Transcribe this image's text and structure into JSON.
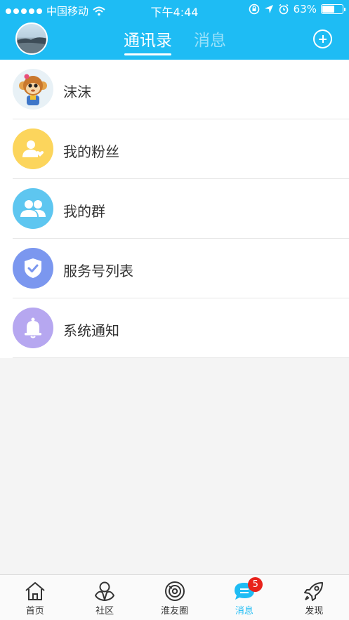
{
  "status_bar": {
    "carrier": "中国移动",
    "time": "下午4:44",
    "battery_percent": "63%",
    "battery_level": 0.63
  },
  "header": {
    "tabs": [
      {
        "label": "通讯录",
        "active": true
      },
      {
        "label": "消息",
        "active": false
      }
    ],
    "add_icon": "plus-circle-icon"
  },
  "contacts": [
    {
      "label": "沫沫",
      "icon": "monkey-avatar"
    },
    {
      "label": "我的粉丝",
      "icon": "fans-icon",
      "color": "#fcd55c"
    },
    {
      "label": "我的群",
      "icon": "group-icon",
      "color": "#5ec6f0"
    },
    {
      "label": "服务号列表",
      "icon": "shield-check-icon",
      "color": "#7b97ef"
    },
    {
      "label": "系统通知",
      "icon": "bell-icon",
      "color": "#b6a7f0"
    }
  ],
  "tab_bar": {
    "items": [
      {
        "label": "首页",
        "icon": "home-icon"
      },
      {
        "label": "社区",
        "icon": "community-icon"
      },
      {
        "label": "淮友圈",
        "icon": "circle-icon"
      },
      {
        "label": "消息",
        "icon": "message-icon",
        "active": true,
        "badge": "5"
      },
      {
        "label": "发现",
        "icon": "rocket-icon"
      }
    ]
  },
  "colors": {
    "brand": "#1ebcf4",
    "badge": "#e8231c"
  }
}
